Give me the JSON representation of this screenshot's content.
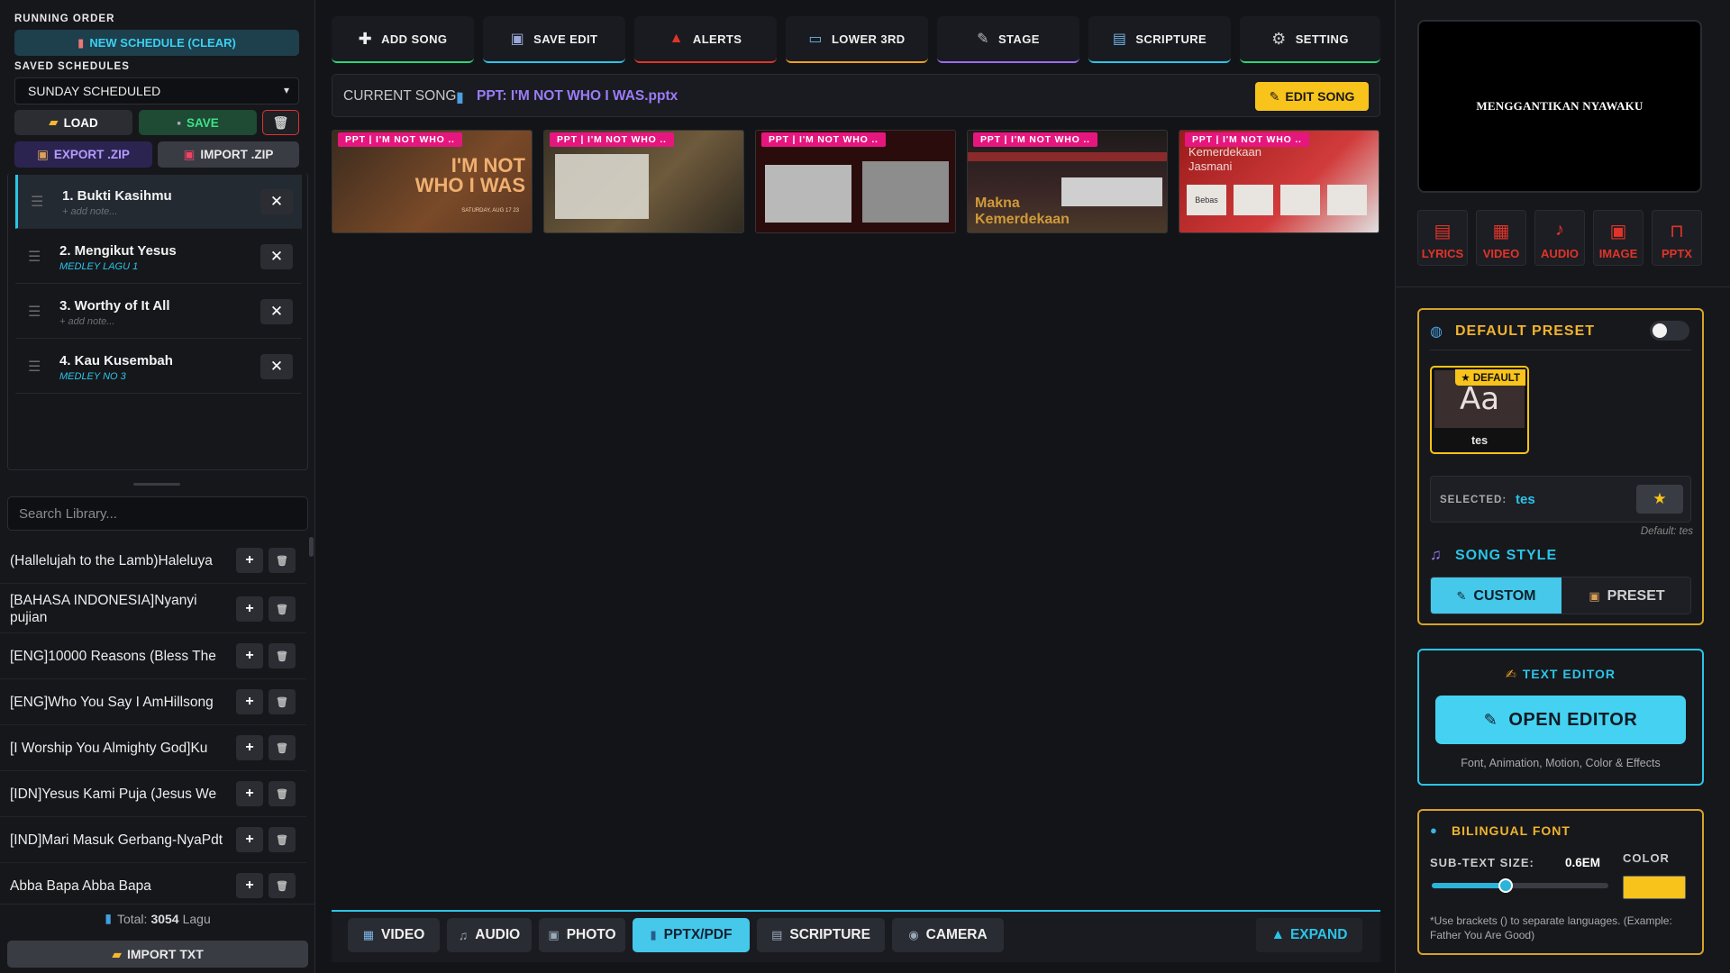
{
  "running_order": {
    "label": "RUNNING ORDER",
    "new_schedule": "NEW SCHEDULE (CLEAR)",
    "saved_label": "SAVED SCHEDULES",
    "selected_schedule": "SUNDAY SCHEDULED",
    "load": "LOAD",
    "save": "SAVE",
    "export": "EXPORT .ZIP",
    "import": "IMPORT .ZIP",
    "items": [
      {
        "title": "1. Bukti Kasihmu",
        "note": "+ add note...",
        "note_type": "placeholder"
      },
      {
        "title": "2. Mengikut Yesus",
        "note": "MEDLEY LAGU 1",
        "note_type": "value"
      },
      {
        "title": "3. Worthy of It All",
        "note": "+ add note...",
        "note_type": "placeholder"
      },
      {
        "title": "4. Kau Kusembah",
        "note": "MEDLEY NO 3",
        "note_type": "value"
      }
    ]
  },
  "library": {
    "search_placeholder": "Search Library...",
    "items": [
      "(Hallelujah to the Lamb)Haleluya",
      "[BAHASA INDONESIA]Nyanyi pujian",
      "[ENG]10000 Reasons (Bless The",
      "[ENG]Who You Say I AmHillsong",
      "[I Worship You Almighty God]Ku",
      "[IDN]Yesus Kami Puja (Jesus We",
      "[IND]Mari Masuk Gerbang-NyaPdt",
      "Abba Bapa Abba Bapa"
    ],
    "total_label": "Total:",
    "total_count": "3054",
    "total_unit": "Lagu",
    "import_txt": "IMPORT TXT"
  },
  "toolbar": {
    "buttons": [
      {
        "label": "ADD SONG",
        "icon": "plus-icon",
        "color": "#2bd47a"
      },
      {
        "label": "SAVE EDIT",
        "icon": "save-icon",
        "color": "#2bc4e8"
      },
      {
        "label": "ALERTS",
        "icon": "siren-icon",
        "color": "#e0342a"
      },
      {
        "label": "LOWER 3RD",
        "icon": "tv-icon",
        "color": "#f0a020"
      },
      {
        "label": "STAGE",
        "icon": "microphone-icon",
        "color": "#9a6cf0"
      },
      {
        "label": "SCRIPTURE",
        "icon": "book-icon",
        "color": "#2bc4e8"
      },
      {
        "label": "SETTING",
        "icon": "gear-icon",
        "color": "#2bd47a"
      }
    ]
  },
  "current_song": {
    "label": "CURRENT SONG:",
    "value": "PPT: I'M NOT WHO I WAS.pptx",
    "edit": "EDIT SONG"
  },
  "slides": {
    "tag": "PPT | I'M NOT WHO ..",
    "items": [
      {
        "big": "I'M NOT WHO I WAS",
        "sub": "SATURDAY, AUG 17 23",
        "kind": "title"
      },
      {
        "big": "",
        "sub": "",
        "kind": "text"
      },
      {
        "big": "",
        "sub": "",
        "kind": "photos"
      },
      {
        "big": "Makna Kemerdekaan",
        "sub": "",
        "kind": "makna"
      },
      {
        "big": "Kemerdekaan Jasmani",
        "sub": "Bebas",
        "kind": "jasmani"
      }
    ]
  },
  "bottom_tabs": {
    "items": [
      {
        "label": "VIDEO",
        "icon": "film-icon"
      },
      {
        "label": "AUDIO",
        "icon": "music-note-icon"
      },
      {
        "label": "PHOTO",
        "icon": "photo-icon"
      },
      {
        "label": "PPTX/PDF",
        "icon": "chart-icon"
      },
      {
        "label": "SCRIPTURE",
        "icon": "book-icon"
      },
      {
        "label": "CAMERA",
        "icon": "camera-icon"
      }
    ],
    "active": "PPTX/PDF",
    "expand": "EXPAND"
  },
  "preview": {
    "text": "MENGGANTIKAN NYAWAKU"
  },
  "media_types": [
    {
      "label": "LYRICS",
      "icon": "document-icon"
    },
    {
      "label": "VIDEO",
      "icon": "clapper-icon"
    },
    {
      "label": "AUDIO",
      "icon": "music-note-icon"
    },
    {
      "label": "IMAGE",
      "icon": "image-icon"
    },
    {
      "label": "PPTX",
      "icon": "presentation-icon"
    }
  ],
  "preset": {
    "title": "DEFAULT PRESET",
    "card_badge": "★ DEFAULT",
    "card_sample": "Aa",
    "card_name": "tes",
    "selected_label": "SELECTED:",
    "selected_value": "tes",
    "default_label": "Default: tes",
    "song_style_title": "SONG STYLE",
    "custom": "CUSTOM",
    "preset_tab": "PRESET"
  },
  "editor": {
    "title": "TEXT EDITOR",
    "open": "OPEN EDITOR",
    "caption": "Font, Animation, Motion, Color & Effects"
  },
  "bilingual": {
    "title": "BILINGUAL FONT",
    "subtext_label": "SUB-TEXT SIZE:",
    "subtext_value": "0.6EM",
    "slider_fraction": 0.42,
    "color_label": "COLOR",
    "color_value": "#f8c31a",
    "hint": "*Use brackets () to separate languages. (Example: Father You Are Good)"
  },
  "colors": {
    "accent_cyan": "#2bc4e8",
    "accent_gold": "#d7a325",
    "accent_red": "#e0342a",
    "accent_purple": "#9a7cf7",
    "accent_pink": "#e6167f"
  }
}
